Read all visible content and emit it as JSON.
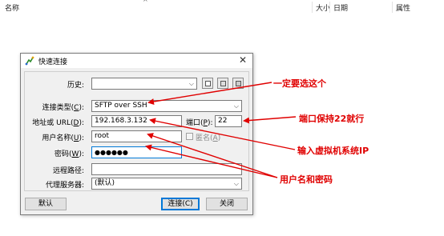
{
  "file_list": {
    "columns": {
      "name": "名称",
      "size": "大小",
      "date": "日期",
      "attributes": "属性"
    },
    "sort_indicator": "^"
  },
  "dialog": {
    "title": "快速连接",
    "close_glyph": "✕",
    "fields": {
      "history": {
        "label": "历史:",
        "value": ""
      },
      "connection_type": {
        "label_pre": "连接类型(",
        "label_key": "C",
        "label_post": "):",
        "value": "SFTP over SSH"
      },
      "address": {
        "label_pre": "地址或 URL(",
        "label_key": "D",
        "label_post": "):",
        "value": "192.168.3.132"
      },
      "port": {
        "label_pre": "端口(",
        "label_key": "P",
        "label_post": "):",
        "value": "22"
      },
      "username": {
        "label_pre": "用户名称(",
        "label_key": "U",
        "label_post": "):",
        "value": "root"
      },
      "anonymous": {
        "label_pre": "匿名(",
        "label_key": "A",
        "label_post": ")",
        "checked": false
      },
      "password": {
        "label_pre": "密码(",
        "label_key": "W",
        "label_post": "):",
        "value": "●●●●●●"
      },
      "remote_path": {
        "label": "远程路径:",
        "value": ""
      },
      "proxy_server": {
        "label": "代理服务器:",
        "value": "(默认)"
      }
    },
    "buttons": {
      "default": "默认",
      "connect": "连接(C)",
      "close": "关闭"
    }
  },
  "annotations": {
    "connection_type_note": "一定要选这个",
    "port_note": "端口保持22就行",
    "address_note": "输入虚拟机系统IP",
    "credentials_note": "用户名和密码"
  },
  "colors": {
    "annotation": "#e00000",
    "focus_border": "#0078d7"
  }
}
